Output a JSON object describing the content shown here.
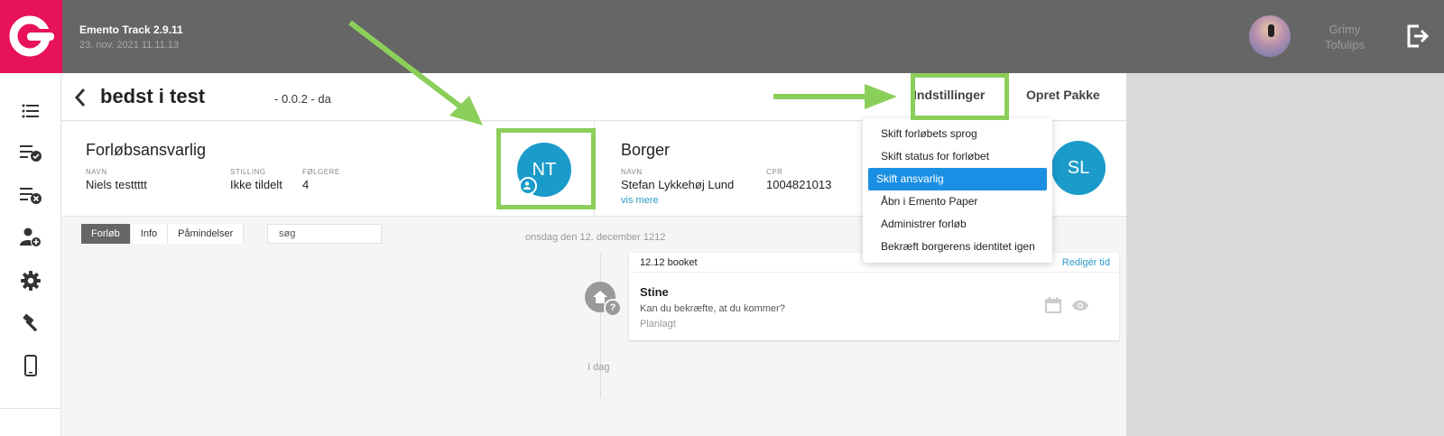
{
  "header": {
    "app_title": "Emento Track 2.9.11",
    "app_date": "23. nov. 2021 11.11.13",
    "user_name": "Grimy Tofulips"
  },
  "sidebar": {
    "items": [
      {
        "icon": "list-icon"
      },
      {
        "icon": "list-check-icon"
      },
      {
        "icon": "list-remove-icon"
      },
      {
        "icon": "add-user-icon"
      },
      {
        "icon": "gear-icon"
      },
      {
        "icon": "hammer-icon"
      },
      {
        "icon": "phone-icon"
      }
    ]
  },
  "page": {
    "title": "bedst i test",
    "subtitle": "- 0.0.2 - da",
    "settings_label": "Indstillinger",
    "create_package_label": "Opret Pakke"
  },
  "responsible": {
    "heading": "Forløbsansvarlig",
    "name_label": "NAVN",
    "name": "Niels testtttt",
    "role_label": "STILLING",
    "role": "Ikke tildelt",
    "followers_label": "FØLGERE",
    "followers": "4",
    "initials": "NT"
  },
  "citizen": {
    "heading": "Borger",
    "name_label": "NAVN",
    "name": "Stefan Lykkehøj Lund",
    "cpr_label": "CPR",
    "cpr": "1004821013",
    "more_link": "vis mere",
    "initials": "SL"
  },
  "tabs": [
    {
      "label": "Forløb",
      "active": true
    },
    {
      "label": "Info",
      "active": false
    },
    {
      "label": "Påmindelser",
      "active": false
    }
  ],
  "search": {
    "value": "søg"
  },
  "timeline": {
    "date_header": "onsdag den 12. december 1212",
    "today_label": "I dag",
    "card": {
      "status": "12.12 booket",
      "edit_link": "Redigér tid",
      "name": "Stine",
      "message": "Kan du bekræfte, at du kommer?",
      "state": "Planlagt"
    }
  },
  "dropdown": {
    "items": [
      {
        "label": "Skift forløbets sprog",
        "active": false
      },
      {
        "label": "Skift status for forløbet",
        "active": false
      },
      {
        "label": "Skift ansvarlig",
        "active": true
      },
      {
        "label": "Åbn i Emento Paper",
        "active": false
      },
      {
        "label": "Administrer forløb",
        "active": false
      },
      {
        "label": "Bekræft borgerens identitet igen",
        "active": false
      }
    ]
  },
  "colors": {
    "brand": "#e8115b",
    "header": "#666666",
    "accent": "#1a9bc9",
    "highlight": "#8bcf5a",
    "selected": "#1a8fe3"
  }
}
